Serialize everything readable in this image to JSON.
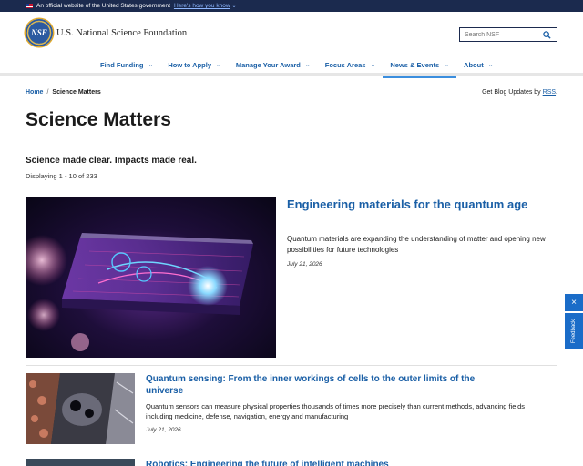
{
  "gov_banner": {
    "text": "An official website of the United States government",
    "link": "Here's how you know"
  },
  "header": {
    "logo_text": "NSF",
    "org_name": "U.S. National Science Foundation",
    "search_placeholder": "Search NSF"
  },
  "nav": {
    "items": [
      {
        "label": "Find Funding"
      },
      {
        "label": "How to Apply"
      },
      {
        "label": "Manage Your Award"
      },
      {
        "label": "Focus Areas"
      },
      {
        "label": "News & Events"
      },
      {
        "label": "About"
      }
    ],
    "active_index": 4
  },
  "breadcrumb": {
    "home": "Home",
    "separator": "/",
    "current": "Science Matters"
  },
  "blog_updates": {
    "text": "Get Blog Updates by",
    "link": "RSS",
    "suffix": "."
  },
  "page": {
    "title": "Science Matters",
    "subtitle": "Science made clear. Impacts made real.",
    "count": "Displaying 1 - 10 of 233"
  },
  "featured": {
    "title": "Engineering materials for the quantum age",
    "description": "Quantum materials are expanding the understanding of matter and opening new possibilities for future technologies",
    "date": "July 21, 2026"
  },
  "articles": [
    {
      "title": "Quantum sensing: From the inner workings of cells to the outer limits of the universe",
      "description": "Quantum sensors can measure physical properties thousands of times more precisely than current methods, advancing fields including medicine, defense, navigation, energy and manufacturing",
      "date": "July 21, 2026"
    },
    {
      "title": "Robotics: Engineering the future of intelligent machines"
    }
  ],
  "feedback": {
    "close_icon": "×",
    "label": "Feedback"
  },
  "colors": {
    "banner_bg": "#1b2a4e",
    "link_blue": "#1a5fa6",
    "feedback_blue": "#1a6cc8"
  }
}
